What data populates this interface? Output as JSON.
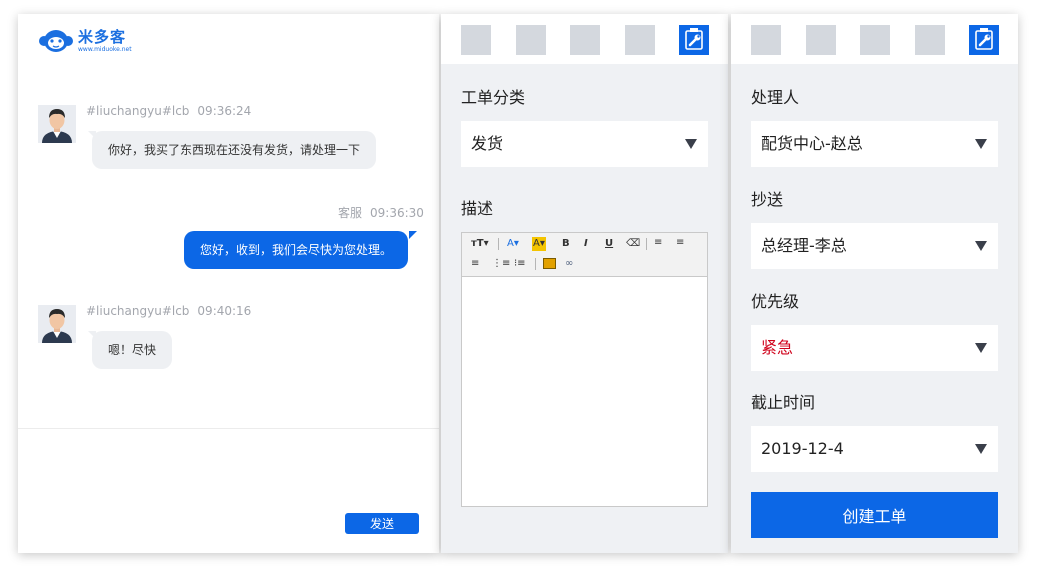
{
  "brand": {
    "name": "米多客",
    "url": "www.miduoke.net"
  },
  "chat": {
    "messages": [
      {
        "sender": "#liuchangyu#lcb",
        "time": "09:36:24",
        "text": "你好，我买了东西现在还没有发货，请处理一下",
        "direction": "in"
      },
      {
        "sender": "客服",
        "time": "09:36:30",
        "text": "您好，收到，我们会尽快为您处理。",
        "direction": "out"
      },
      {
        "sender": "#liuchangyu#lcb",
        "time": "09:40:16",
        "text": "嗯！尽快",
        "direction": "in"
      }
    ],
    "send_label": "发送"
  },
  "ticket_form": {
    "category_label": "工单分类",
    "category_value": "发货",
    "description_label": "描述",
    "editor_tools": [
      "font-size-icon",
      "font-color-icon",
      "highlight-icon",
      "bold-icon",
      "italic-icon",
      "underline-icon",
      "eraser-icon",
      "align-left-icon",
      "align-center-icon",
      "align-right-icon",
      "ordered-list-icon",
      "unordered-list-icon",
      "image-icon",
      "link-icon"
    ]
  },
  "assign_form": {
    "handler_label": "处理人",
    "handler_value": "配货中心-赵总",
    "cc_label": "抄送",
    "cc_value": "总经理-李总",
    "priority_label": "优先级",
    "priority_value": "紧急",
    "deadline_label": "截止时间",
    "deadline_value": "2019-12-4",
    "create_label": "创建工单"
  },
  "colors": {
    "accent": "#0c67e6",
    "urgent": "#d0021b",
    "panel_bg": "#eff1f4",
    "tab_inactive": "#d4d8de"
  }
}
